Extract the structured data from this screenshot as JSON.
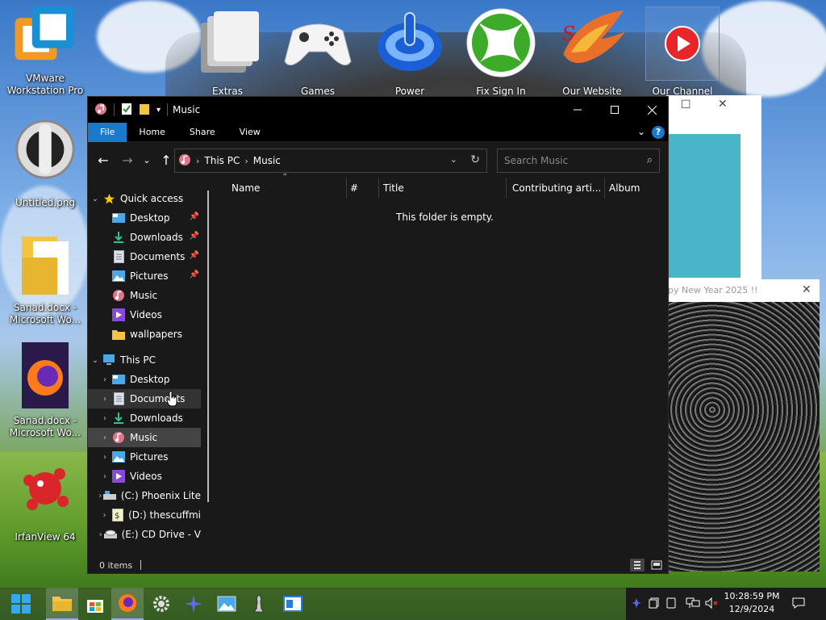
{
  "desktop": {
    "left_icons": [
      {
        "label": "VMware Workstation Pro"
      },
      {
        "label": "Untitled.png"
      },
      {
        "label": "Sanad.docx - Microsoft Wo..."
      },
      {
        "label": "Sanad.docx - Microsoft Wo..."
      },
      {
        "label": "IrfanView 64"
      }
    ],
    "top_icons": [
      {
        "label": "Extras"
      },
      {
        "label": "Games"
      },
      {
        "label": "Power"
      },
      {
        "label": "Fix Sign In"
      },
      {
        "label": "Our Website"
      },
      {
        "label": "Our Channel"
      }
    ],
    "bg_window_title": "py New Year 2025 !!"
  },
  "explorer": {
    "title": "Music",
    "ribbon_tabs": [
      "File",
      "Home",
      "Share",
      "View"
    ],
    "help": "?",
    "breadcrumb": [
      "This PC",
      "Music"
    ],
    "search_placeholder": "Search Music",
    "nav": {
      "quick_access": "Quick access",
      "quick_items": [
        "Desktop",
        "Downloads",
        "Documents",
        "Pictures",
        "Music",
        "Videos",
        "wallpapers"
      ],
      "this_pc": "This PC",
      "pc_items": [
        "Desktop",
        "Documents",
        "Downloads",
        "Music",
        "Pictures",
        "Videos",
        "(C:) Phoenix Lite",
        "(D:) thescuffmi",
        "(E:) CD Drive - V"
      ]
    },
    "columns": [
      "Name",
      "#",
      "Title",
      "Contributing arti...",
      "Album"
    ],
    "empty_message": "This folder is empty.",
    "status": "0 items"
  },
  "taskbar": {
    "time": "10:28:59 PM",
    "date": "12/9/2024"
  },
  "colors": {
    "accent": "#1979ca",
    "window_bg": "#191919",
    "titlebar_bg": "#000000",
    "selected_row": "#444444"
  }
}
